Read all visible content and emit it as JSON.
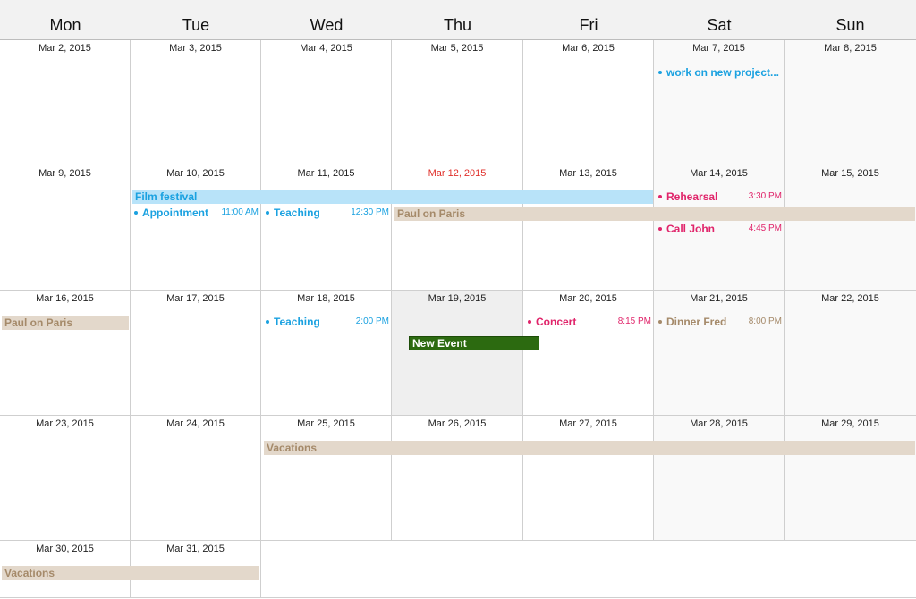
{
  "weekdays": [
    "Mon",
    "Tue",
    "Wed",
    "Thu",
    "Fri",
    "Sat",
    "Sun"
  ],
  "colors": {
    "blue": "#1aa1e0",
    "red": "#e0246a",
    "tan": "#a58a6a",
    "today": "#e0302b",
    "new_event": "#2c6a10"
  },
  "weeks": [
    {
      "days": [
        "Mar 2, 2015",
        "Mar 3, 2015",
        "Mar 4, 2015",
        "Mar 5, 2015",
        "Mar 6, 2015",
        "Mar 7, 2015",
        "Mar 8, 2015"
      ]
    },
    {
      "days": [
        "Mar 9, 2015",
        "Mar 10, 2015",
        "Mar 11, 2015",
        "Mar 12, 2015",
        "Mar 13, 2015",
        "Mar 14, 2015",
        "Mar 15, 2015"
      ]
    },
    {
      "days": [
        "Mar 16, 2015",
        "Mar 17, 2015",
        "Mar 18, 2015",
        "Mar 19, 2015",
        "Mar 20, 2015",
        "Mar 21, 2015",
        "Mar 22, 2015"
      ]
    },
    {
      "days": [
        "Mar 23, 2015",
        "Mar 24, 2015",
        "Mar 25, 2015",
        "Mar 26, 2015",
        "Mar 27, 2015",
        "Mar 28, 2015",
        "Mar 29, 2015"
      ]
    },
    {
      "days": [
        "Mar 30, 2015",
        "Mar 31, 2015"
      ]
    }
  ],
  "today": "Mar 12, 2015",
  "selected_day": "Mar 19, 2015",
  "all_day_events": {
    "film_festival": "Film festival",
    "paul_on_paris": "Paul on Paris",
    "vacations": "Vacations",
    "new_event": "New Event"
  },
  "timed_events": {
    "work_project": {
      "title": "work on new project...",
      "time": ""
    },
    "appointment": {
      "title": "Appointment",
      "time": "11:00 AM"
    },
    "teaching_1": {
      "title": "Teaching",
      "time": "12:30 PM"
    },
    "rehearsal": {
      "title": "Rehearsal",
      "time": "3:30 PM"
    },
    "call_john": {
      "title": "Call John",
      "time": "4:45 PM"
    },
    "teaching_2": {
      "title": "Teaching",
      "time": "2:00 PM"
    },
    "concert": {
      "title": "Concert",
      "time": "8:15 PM"
    },
    "dinner_fred": {
      "title": "Dinner Fred",
      "time": "8:00 PM"
    }
  }
}
